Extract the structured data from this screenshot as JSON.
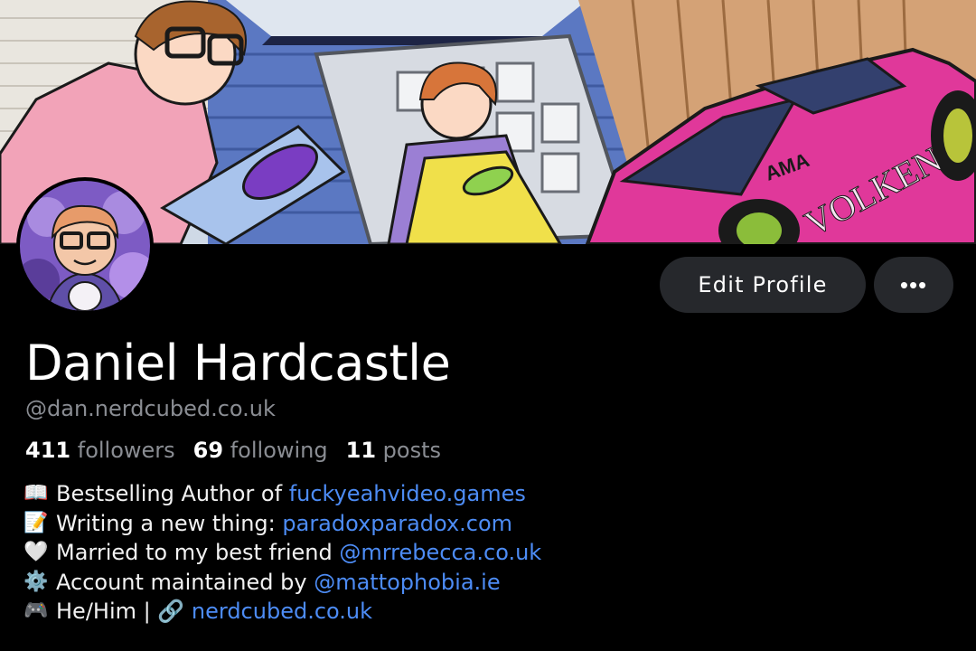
{
  "profile": {
    "display_name": "Daniel Hardcastle",
    "handle": "@dan.nerdcubed.co.uk"
  },
  "actions": {
    "edit_label": "Edit Profile",
    "more_label": "•••"
  },
  "stats": {
    "followers_count": "411",
    "followers_label": "followers",
    "following_count": "69",
    "following_label": "following",
    "posts_count": "11",
    "posts_label": "posts"
  },
  "bio": {
    "line1_icon": "📖",
    "line1_text": "Bestselling Author of ",
    "line1_link": "fuckyeahvideo.games",
    "line2_icon": "📝",
    "line2_text": "Writing a new thing: ",
    "line2_link": "paradoxparadox.com",
    "line3_icon": "🤍",
    "line3_text": "Married to my best friend ",
    "line3_link": "@mrrebecca.co.uk",
    "line4_icon": "⚙️",
    "line4_text": "Account maintained by ",
    "line4_link": "@mattophobia.ie",
    "line5_icon": "🎮",
    "line5_text": "He/Him | ",
    "line5_icon2": "🔗",
    "line5_link": "nerdcubed.co.uk"
  },
  "banner": {
    "car_text_1": "AMA",
    "car_text_2": "VOLKEN"
  },
  "colors": {
    "background": "#000000",
    "button_bg": "#26282c",
    "link": "#4d8cf5",
    "muted": "#8a8d93",
    "car_pink": "#e0389a"
  },
  "icons": {
    "more": "more-horizontal-icon",
    "link": "link-icon"
  }
}
